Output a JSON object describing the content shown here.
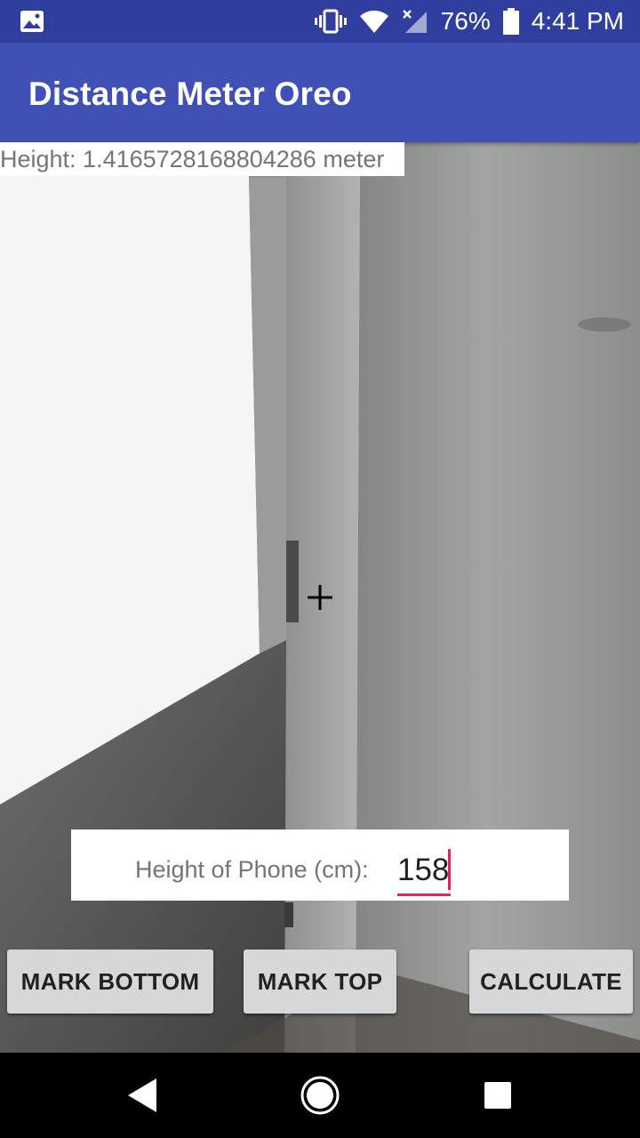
{
  "status_bar": {
    "battery_percent": "76%",
    "time": "4:41 PM",
    "icons": [
      "image-notification-icon",
      "vibrate-icon",
      "wifi-icon",
      "no-signal-icon",
      "battery-icon"
    ]
  },
  "app_bar": {
    "title": "Distance Meter Oreo",
    "color": "#3F51B5",
    "status_color": "#303F9F"
  },
  "readout": {
    "height_text": "Height: 1.4165728168804286 meter"
  },
  "phone_height": {
    "label": "Height of Phone (cm):",
    "value": "158",
    "accent": "#E91E63"
  },
  "buttons": {
    "mark_bottom": "MARK BOTTOM",
    "mark_top": "MARK TOP",
    "calculate": "CALCULATE"
  },
  "nav_bar": {
    "icons": [
      "back-icon",
      "home-icon",
      "recents-icon"
    ]
  }
}
